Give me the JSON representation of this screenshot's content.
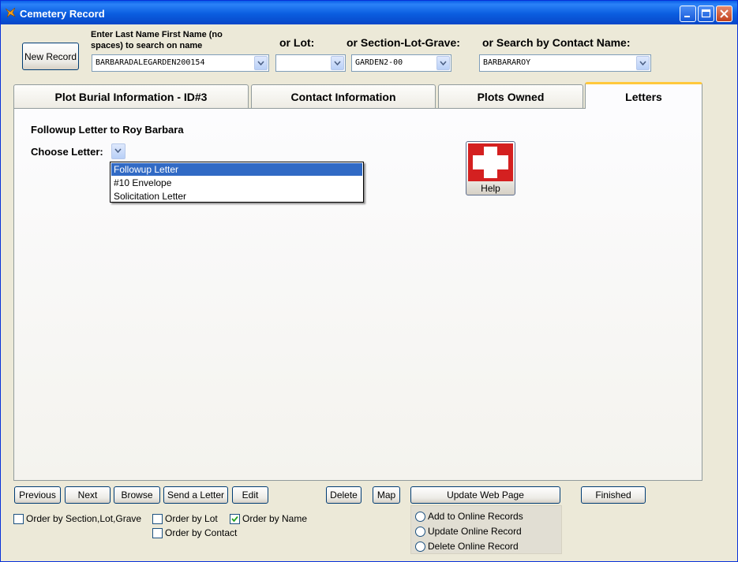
{
  "window": {
    "title": "Cemetery Record"
  },
  "search": {
    "name_label": "Enter Last Name First Name (no spaces) to search on name",
    "name_value": "BARBARADALEGARDEN200154",
    "lot_label": "or Lot:",
    "lot_value": "",
    "slg_label": "or Section-Lot-Grave:",
    "slg_value": "GARDEN2-00",
    "contact_label": "or Search by Contact Name:",
    "contact_value": "BARBARAROY"
  },
  "new_record_label": "New Record",
  "tabs": [
    {
      "label": "Plot Burial Information - ID#3"
    },
    {
      "label": "Contact Information"
    },
    {
      "label": "Plots Owned"
    },
    {
      "label": "Letters"
    }
  ],
  "letters": {
    "heading": "Followup Letter to Roy Barbara",
    "choose_label": "Choose Letter:",
    "options": [
      "Followup Letter",
      "#10 Envelope",
      "Solicitation Letter"
    ],
    "selected_index": 0,
    "help_label": "Help"
  },
  "toolbar": {
    "previous": "Previous",
    "next": "Next",
    "browse": "Browse",
    "send_letter": "Send a Letter",
    "edit": "Edit",
    "delete": "Delete",
    "map": "Map",
    "update_web": "Update Web Page",
    "finished": "Finished"
  },
  "ordering": {
    "by_section": {
      "label": "Order by Section,Lot,Grave",
      "checked": false
    },
    "by_lot": {
      "label": "Order by Lot",
      "checked": false
    },
    "by_name": {
      "label": "Order by Name",
      "checked": true
    },
    "by_contact": {
      "label": "Order by Contact",
      "checked": false
    }
  },
  "online": {
    "add": "Add to Online Records",
    "update": "Update Online Record",
    "delete": "Delete Online Record"
  },
  "colors": {
    "titlebar": "#0a5fe8",
    "selection": "#316ac5",
    "tab_highlight": "#ffc83c",
    "help_red": "#d42020"
  }
}
